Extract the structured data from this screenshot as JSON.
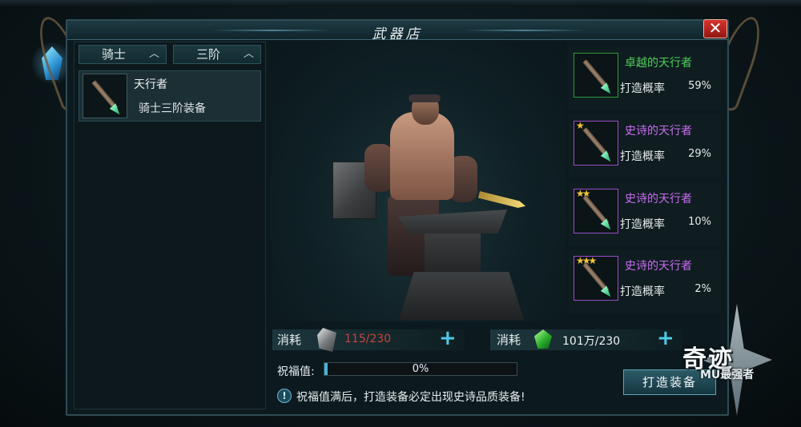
{
  "window": {
    "title": "武器店"
  },
  "filters": [
    {
      "label": "骑士"
    },
    {
      "label": "三阶"
    }
  ],
  "item_list": [
    {
      "name": "天行者",
      "subtitle": "骑士三阶装备"
    }
  ],
  "results": [
    {
      "name": "卓越的天行者",
      "rate_label": "打造概率",
      "rate": "59%",
      "color": "#4fd05a",
      "stars": ""
    },
    {
      "name": "史诗的天行者",
      "rate_label": "打造概率",
      "rate": "29%",
      "color": "#c86cf0",
      "stars": "★"
    },
    {
      "name": "史诗的天行者",
      "rate_label": "打造概率",
      "rate": "10%",
      "color": "#c86cf0",
      "stars": "★★"
    },
    {
      "name": "史诗的天行者",
      "rate_label": "打造概率",
      "rate": "2%",
      "color": "#c86cf0",
      "stars": "★★★"
    }
  ],
  "costs": [
    {
      "label": "消耗",
      "value": "115/230",
      "color": "#c6443c",
      "icon": "ore-icon"
    },
    {
      "label": "消耗",
      "value": "101万/230",
      "color": "#eef2f4",
      "icon": "green-gem-icon"
    }
  ],
  "blessing": {
    "label": "祝福值:",
    "percent_text": "0%",
    "fill": 0
  },
  "tip": {
    "icon": "!",
    "text": "祝福值满后，打造装备必定出现史诗品质装备!"
  },
  "forge_button": {
    "label": "打造装备"
  },
  "close_button": {
    "label": "✕"
  },
  "logo": {
    "main": "奇迹",
    "sub": "MU最强者"
  }
}
